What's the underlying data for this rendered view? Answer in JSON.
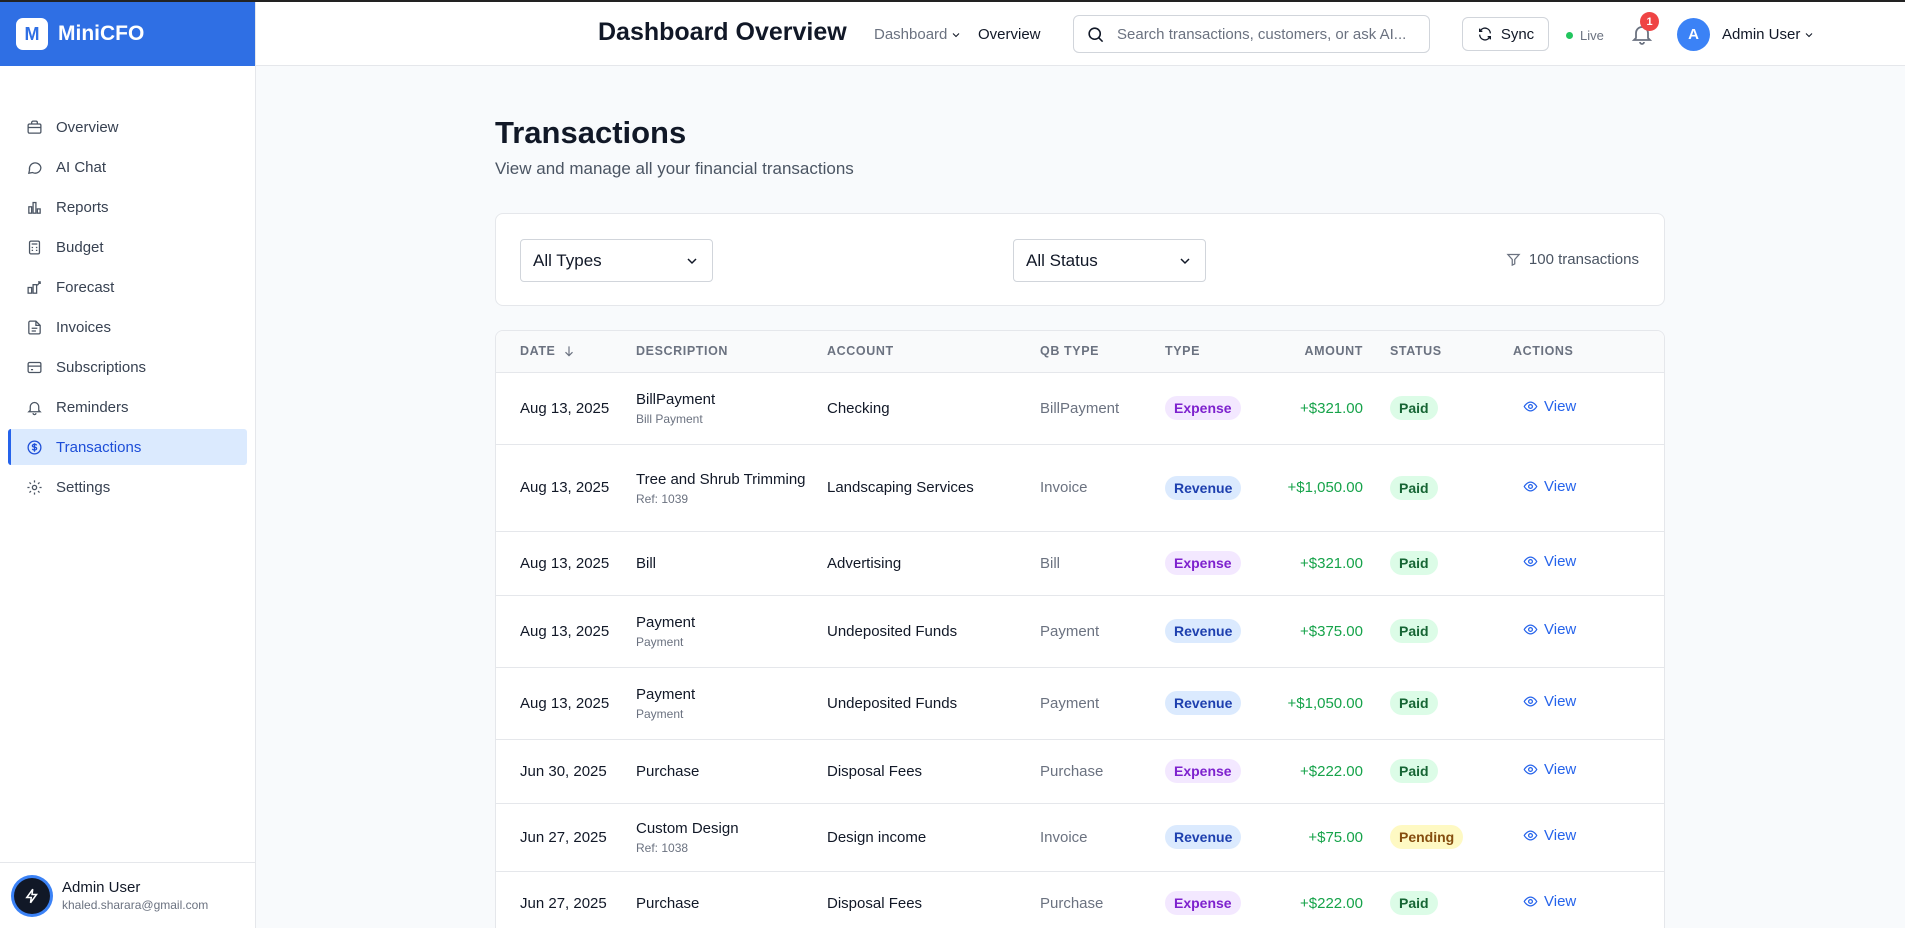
{
  "brand": {
    "logo_letter": "M",
    "name": "MiniCFO"
  },
  "sidebar": {
    "items": [
      {
        "label": "Overview",
        "icon": "briefcase-icon"
      },
      {
        "label": "AI Chat",
        "icon": "chat-icon"
      },
      {
        "label": "Reports",
        "icon": "bar-chart-icon"
      },
      {
        "label": "Budget",
        "icon": "calculator-icon"
      },
      {
        "label": "Forecast",
        "icon": "forecast-icon"
      },
      {
        "label": "Invoices",
        "icon": "file-icon"
      },
      {
        "label": "Subscriptions",
        "icon": "credit-card-icon"
      },
      {
        "label": "Reminders",
        "icon": "bell-icon"
      },
      {
        "label": "Transactions",
        "icon": "dollar-circle-icon",
        "active": true
      },
      {
        "label": "Settings",
        "icon": "gear-icon"
      }
    ],
    "footer": {
      "name": "Admin User",
      "email": "khaled.sharara@gmail.com"
    }
  },
  "header": {
    "title": "Dashboard Overview",
    "nav_dashboard": "Dashboard",
    "nav_overview": "Overview",
    "search_placeholder": "Search transactions, customers, or ask AI...",
    "sync_label": "Sync",
    "live_label": "Live",
    "notification_count": "1",
    "user_initial": "A",
    "user_name": "Admin User"
  },
  "page": {
    "title": "Transactions",
    "subtitle": "View and manage all your financial transactions"
  },
  "filters": {
    "type_selected": "All Types",
    "status_selected": "All Status",
    "count_label": "100 transactions"
  },
  "table": {
    "headers": [
      "Date",
      "Description",
      "Account",
      "QB Type",
      "Type",
      "Amount",
      "Status",
      "Actions"
    ],
    "rows": [
      {
        "date": "Aug 13, 2025",
        "desc": "BillPayment",
        "sub": "Bill Payment",
        "account": "Checking",
        "qbtype": "BillPayment",
        "type": "Expense",
        "amount": "+$321.00",
        "status": "Paid",
        "action": "View"
      },
      {
        "date": "Aug 13, 2025",
        "desc": "Tree and Shrub Trimming",
        "sub": "Ref: 1039",
        "account": "Landscaping Services",
        "qbtype": "Invoice",
        "type": "Revenue",
        "amount": "+$1,050.00",
        "status": "Paid",
        "action": "View"
      },
      {
        "date": "Aug 13, 2025",
        "desc": "Bill",
        "sub": "",
        "account": "Advertising",
        "qbtype": "Bill",
        "type": "Expense",
        "amount": "+$321.00",
        "status": "Paid",
        "action": "View"
      },
      {
        "date": "Aug 13, 2025",
        "desc": "Payment",
        "sub": "Payment",
        "account": "Undeposited Funds",
        "qbtype": "Payment",
        "type": "Revenue",
        "amount": "+$375.00",
        "status": "Paid",
        "action": "View"
      },
      {
        "date": "Aug 13, 2025",
        "desc": "Payment",
        "sub": "Payment",
        "account": "Undeposited Funds",
        "qbtype": "Payment",
        "type": "Revenue",
        "amount": "+$1,050.00",
        "status": "Paid",
        "action": "View"
      },
      {
        "date": "Jun 30, 2025",
        "desc": "Purchase",
        "sub": "",
        "account": "Disposal Fees",
        "qbtype": "Purchase",
        "type": "Expense",
        "amount": "+$222.00",
        "status": "Paid",
        "action": "View"
      },
      {
        "date": "Jun 27, 2025",
        "desc": "Custom Design",
        "sub": "Ref: 1038",
        "account": "Design income",
        "qbtype": "Invoice",
        "type": "Revenue",
        "amount": "+$75.00",
        "status": "Pending",
        "action": "View"
      },
      {
        "date": "Jun 27, 2025",
        "desc": "Purchase",
        "sub": "",
        "account": "Disposal Fees",
        "qbtype": "Purchase",
        "type": "Expense",
        "amount": "+$222.00",
        "status": "Paid",
        "action": "View"
      }
    ]
  }
}
